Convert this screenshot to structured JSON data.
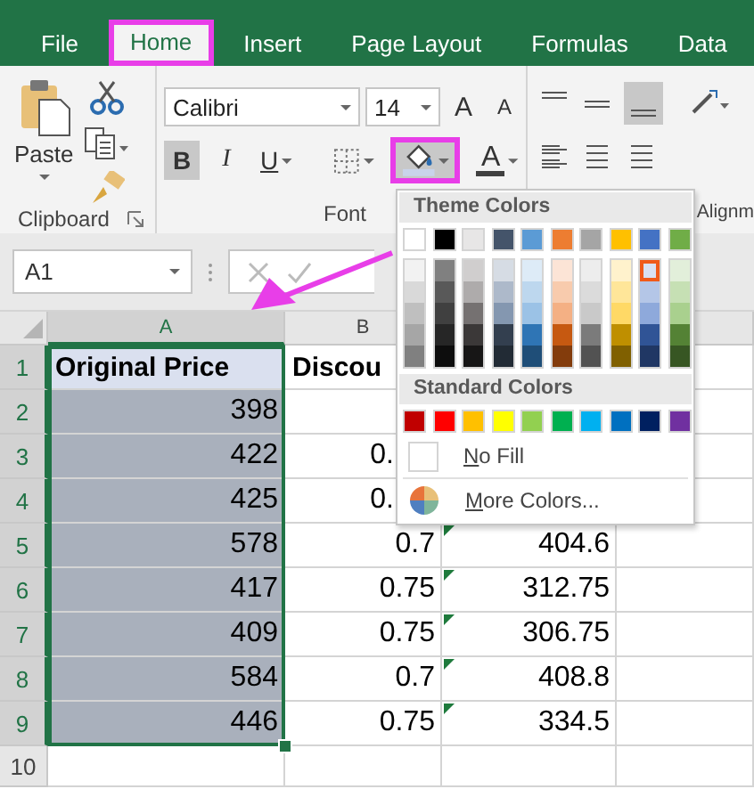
{
  "tabs": [
    {
      "label": "File",
      "selected": false,
      "highlighted": false
    },
    {
      "label": "Home",
      "selected": true,
      "highlighted": true
    },
    {
      "label": "Insert",
      "selected": false,
      "highlighted": false
    },
    {
      "label": "Page Layout",
      "selected": false,
      "highlighted": false
    },
    {
      "label": "Formulas",
      "selected": false,
      "highlighted": false
    },
    {
      "label": "Data",
      "selected": false,
      "highlighted": false
    }
  ],
  "ribbon": {
    "clipboard": {
      "label": "Clipboard",
      "paste_label": "Paste"
    },
    "font": {
      "label": "Font",
      "font_name": "Calibri",
      "font_size": "14",
      "grow_label": "A",
      "shrink_label": "A",
      "buttons": [
        {
          "kind": "bold",
          "text": "B",
          "on": true,
          "highlighted": false
        },
        {
          "kind": "italic",
          "text": "I",
          "on": false,
          "highlighted": false
        },
        {
          "kind": "underline",
          "text": "U",
          "on": false,
          "highlighted": false
        },
        {
          "kind": "borders",
          "on": false,
          "highlighted": false
        },
        {
          "kind": "fill-color",
          "on": true,
          "highlighted": true
        },
        {
          "kind": "font-color",
          "text": "A",
          "on": false,
          "highlighted": false
        }
      ]
    },
    "alignment": {
      "label": "Alignm",
      "bottom_align_on": true
    }
  },
  "formula_bar": {
    "name_box": "A1"
  },
  "sheet": {
    "columns": [
      {
        "label": "A",
        "selected": true
      },
      {
        "label": "B",
        "selected": false
      }
    ],
    "rows": [
      {
        "number": "1",
        "selected": true,
        "a": {
          "text": "Original Price",
          "kind": "text",
          "bold": true,
          "color": "#dae0ef"
        },
        "b": {
          "text": "Discou",
          "kind": "text",
          "bold": true
        }
      },
      {
        "number": "2",
        "selected": true,
        "a": {
          "text": "398",
          "kind": "number",
          "bold": false,
          "color": "#a9b0bc"
        }
      },
      {
        "number": "3",
        "selected": true,
        "a": {
          "text": "422",
          "kind": "number",
          "bold": false,
          "color": "#a9b0bc"
        },
        "b": {
          "text": "0.",
          "kind": "cut",
          "bold": false
        }
      },
      {
        "number": "4",
        "selected": true,
        "a": {
          "text": "425",
          "kind": "number",
          "bold": false,
          "color": "#a9b0bc"
        },
        "b": {
          "text": "0.",
          "kind": "cut",
          "bold": false
        }
      },
      {
        "number": "5",
        "selected": true,
        "a": {
          "text": "578",
          "kind": "number",
          "bold": false,
          "color": "#a9b0bc"
        },
        "b": {
          "text": "0.7",
          "kind": "number",
          "bold": false
        },
        "c": {
          "text": "404.6",
          "kind": "number",
          "bold": false,
          "error_mark": true
        }
      },
      {
        "number": "6",
        "selected": true,
        "a": {
          "text": "417",
          "kind": "number",
          "bold": false,
          "color": "#a9b0bc"
        },
        "b": {
          "text": "0.75",
          "kind": "number",
          "bold": false
        },
        "c": {
          "text": "312.75",
          "kind": "number",
          "bold": false,
          "error_mark": true
        }
      },
      {
        "number": "7",
        "selected": true,
        "a": {
          "text": "409",
          "kind": "number",
          "bold": false,
          "color": "#a9b0bc"
        },
        "b": {
          "text": "0.75",
          "kind": "number",
          "bold": false
        },
        "c": {
          "text": "306.75",
          "kind": "number",
          "bold": false,
          "error_mark": true
        }
      },
      {
        "number": "8",
        "selected": true,
        "a": {
          "text": "584",
          "kind": "number",
          "bold": false,
          "color": "#a9b0bc"
        },
        "b": {
          "text": "0.7",
          "kind": "number",
          "bold": false
        },
        "c": {
          "text": "408.8",
          "kind": "number",
          "bold": false,
          "error_mark": true
        }
      },
      {
        "number": "9",
        "selected": true,
        "a": {
          "text": "446",
          "kind": "number",
          "bold": false,
          "color": "#a9b0bc"
        },
        "b": {
          "text": "0.75",
          "kind": "number",
          "bold": false
        },
        "c": {
          "text": "334.5",
          "kind": "number",
          "bold": false,
          "error_mark": true
        }
      },
      {
        "number": "10",
        "selected": false
      }
    ]
  },
  "color_menu": {
    "theme_title": "Theme Colors",
    "theme_top": [
      {
        "color": "#ffffff",
        "selected": false
      },
      {
        "color": "#000000",
        "selected": false
      },
      {
        "color": "#e7e6e6",
        "selected": false
      },
      {
        "color": "#44546a",
        "selected": false
      },
      {
        "color": "#5b9bd5",
        "selected": false
      },
      {
        "color": "#ed7d31",
        "selected": false
      },
      {
        "color": "#a5a5a5",
        "selected": false
      },
      {
        "color": "#ffc000",
        "selected": false
      },
      {
        "color": "#4472c4",
        "selected": false
      },
      {
        "color": "#70ad47",
        "selected": false
      }
    ],
    "theme_shades": [
      [
        {
          "color": "#f2f2f2",
          "selected": false
        },
        {
          "color": "#d9d9d9",
          "selected": false
        },
        {
          "color": "#bfbfbf",
          "selected": false
        },
        {
          "color": "#a6a6a6",
          "selected": false
        },
        {
          "color": "#808080",
          "selected": false
        }
      ],
      [
        {
          "color": "#808080",
          "selected": false
        },
        {
          "color": "#595959",
          "selected": false
        },
        {
          "color": "#404040",
          "selected": false
        },
        {
          "color": "#262626",
          "selected": false
        },
        {
          "color": "#0d0d0d",
          "selected": false
        }
      ],
      [
        {
          "color": "#d0cece",
          "selected": false
        },
        {
          "color": "#aeabab",
          "selected": false
        },
        {
          "color": "#757171",
          "selected": false
        },
        {
          "color": "#3b3838",
          "selected": false
        },
        {
          "color": "#171616",
          "selected": false
        }
      ],
      [
        {
          "color": "#d6dce4",
          "selected": false
        },
        {
          "color": "#adb9ca",
          "selected": false
        },
        {
          "color": "#8497b0",
          "selected": false
        },
        {
          "color": "#333f4f",
          "selected": false
        },
        {
          "color": "#222b35",
          "selected": false
        }
      ],
      [
        {
          "color": "#ddebf7",
          "selected": false
        },
        {
          "color": "#bdd7ee",
          "selected": false
        },
        {
          "color": "#9bc2e6",
          "selected": false
        },
        {
          "color": "#2f75b5",
          "selected": false
        },
        {
          "color": "#1f4e78",
          "selected": false
        }
      ],
      [
        {
          "color": "#fce4d6",
          "selected": false
        },
        {
          "color": "#f8cbad",
          "selected": false
        },
        {
          "color": "#f4b084",
          "selected": false
        },
        {
          "color": "#c65911",
          "selected": false
        },
        {
          "color": "#833c0c",
          "selected": false
        }
      ],
      [
        {
          "color": "#ededed",
          "selected": false
        },
        {
          "color": "#dbdbdb",
          "selected": false
        },
        {
          "color": "#c9c9c9",
          "selected": false
        },
        {
          "color": "#7b7b7b",
          "selected": false
        },
        {
          "color": "#525252",
          "selected": false
        }
      ],
      [
        {
          "color": "#fff2cc",
          "selected": false
        },
        {
          "color": "#ffe699",
          "selected": false
        },
        {
          "color": "#ffd966",
          "selected": false
        },
        {
          "color": "#bf8f00",
          "selected": false
        },
        {
          "color": "#806000",
          "selected": false
        }
      ],
      [
        {
          "color": "#d9e1f2",
          "selected": true
        },
        {
          "color": "#b4c6e7",
          "selected": false
        },
        {
          "color": "#8ea9db",
          "selected": false
        },
        {
          "color": "#305496",
          "selected": false
        },
        {
          "color": "#203764",
          "selected": false
        }
      ],
      [
        {
          "color": "#e2efda",
          "selected": false
        },
        {
          "color": "#c6e0b4",
          "selected": false
        },
        {
          "color": "#a9d08e",
          "selected": false
        },
        {
          "color": "#548235",
          "selected": false
        },
        {
          "color": "#375623",
          "selected": false
        }
      ]
    ],
    "standard_title": "Standard Colors",
    "standard": [
      {
        "color": "#c00000",
        "selected": false
      },
      {
        "color": "#ff0000",
        "selected": false
      },
      {
        "color": "#ffc000",
        "selected": false
      },
      {
        "color": "#ffff00",
        "selected": false
      },
      {
        "color": "#92d050",
        "selected": false
      },
      {
        "color": "#00b050",
        "selected": false
      },
      {
        "color": "#00b0f0",
        "selected": false
      },
      {
        "color": "#0070c0",
        "selected": false
      },
      {
        "color": "#002060",
        "selected": false
      },
      {
        "color": "#7030a0",
        "selected": false
      }
    ],
    "items": [
      {
        "kind": "no-fill",
        "label": "No Fill"
      },
      {
        "kind": "more-colors",
        "label": "More Colors..."
      }
    ]
  }
}
